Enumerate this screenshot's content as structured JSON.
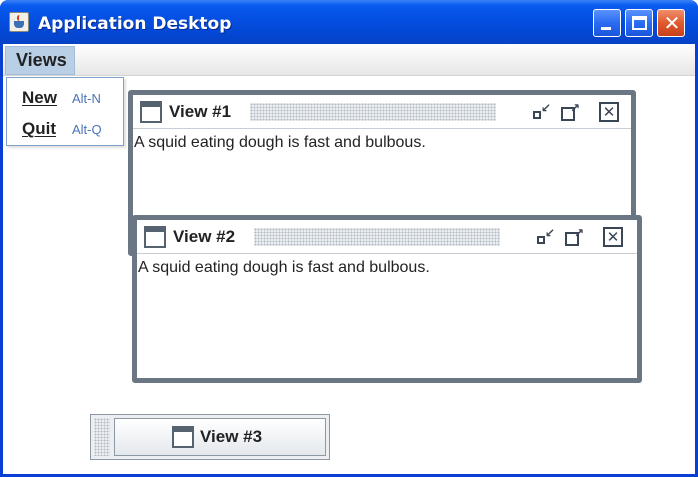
{
  "window": {
    "title": "Application Desktop",
    "colors": {
      "titlebar": "#0450e3",
      "close": "#e05a2e",
      "frame_border": "#6a7684",
      "menu_highlight": "#b8cfe5",
      "accelerator": "#4a74b8"
    }
  },
  "menubar": {
    "items": [
      {
        "label": "Views",
        "open": true
      }
    ]
  },
  "views_menu": {
    "items": [
      {
        "label": "New",
        "mnemonic": "N",
        "accelerator": "Alt-N"
      },
      {
        "label": "Quit",
        "mnemonic": "Q",
        "accelerator": "Alt-Q"
      }
    ]
  },
  "frames": [
    {
      "title": "View #1",
      "content": "A squid eating dough is fast and bulbous."
    },
    {
      "title": "View #2",
      "content": "A squid eating dough is fast and bulbous."
    }
  ],
  "iconified_frames": [
    {
      "title": "View #3"
    }
  ]
}
